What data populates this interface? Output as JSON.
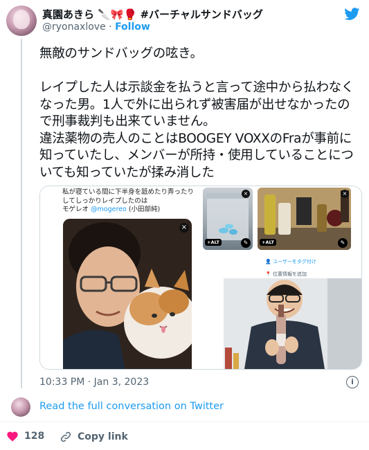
{
  "author": {
    "display_name": "真園あきら 🔪🎀🥊 #バーチャルサンドバッグ",
    "handle": "@ryonaxlove",
    "separator": "·",
    "follow_label": "Follow"
  },
  "tweet": {
    "text": "無敵のサンドバッグの呟き。\n\nレイプした人は示談金を払うと言って途中から払わなくなった男。1人で外に出られず被害届が出せなかったので刑事裁判も出来ていません。\n違法薬物の売人のことはBOOGEY VOXXのFraが事前に知っていたし、メンバーが所持・使用していることについても知っていたが揉み消した",
    "timestamp": "10:33 PM · Jan 3, 2023"
  },
  "media": {
    "left_caption_line1": "私が寝ている間に下半身を舐めたり弄ったり",
    "left_caption_line2": "してしっかりレイプしたのは",
    "left_caption_line3_prefix": "モゲレオ ",
    "left_caption_link": "@mogereo",
    "left_caption_line3_suffix": " (小田部純)",
    "close_glyph": "×",
    "alt_label": "+ALT",
    "tag_people": "ユーザーをタグ付け",
    "add_location": "位置情報を追加"
  },
  "footer": {
    "read_more": "Read the full conversation on Twitter",
    "like_count": "128",
    "copy_link": "Copy link",
    "info_glyph": "i"
  },
  "colors": {
    "accent": "#1d9bf0",
    "like": "#f91880",
    "muted": "#536471"
  },
  "icons": [
    "twitter-bird-icon",
    "info-icon",
    "heart-icon",
    "link-icon",
    "close-icon",
    "pen-icon",
    "person-tag-icon",
    "location-pin-icon"
  ]
}
